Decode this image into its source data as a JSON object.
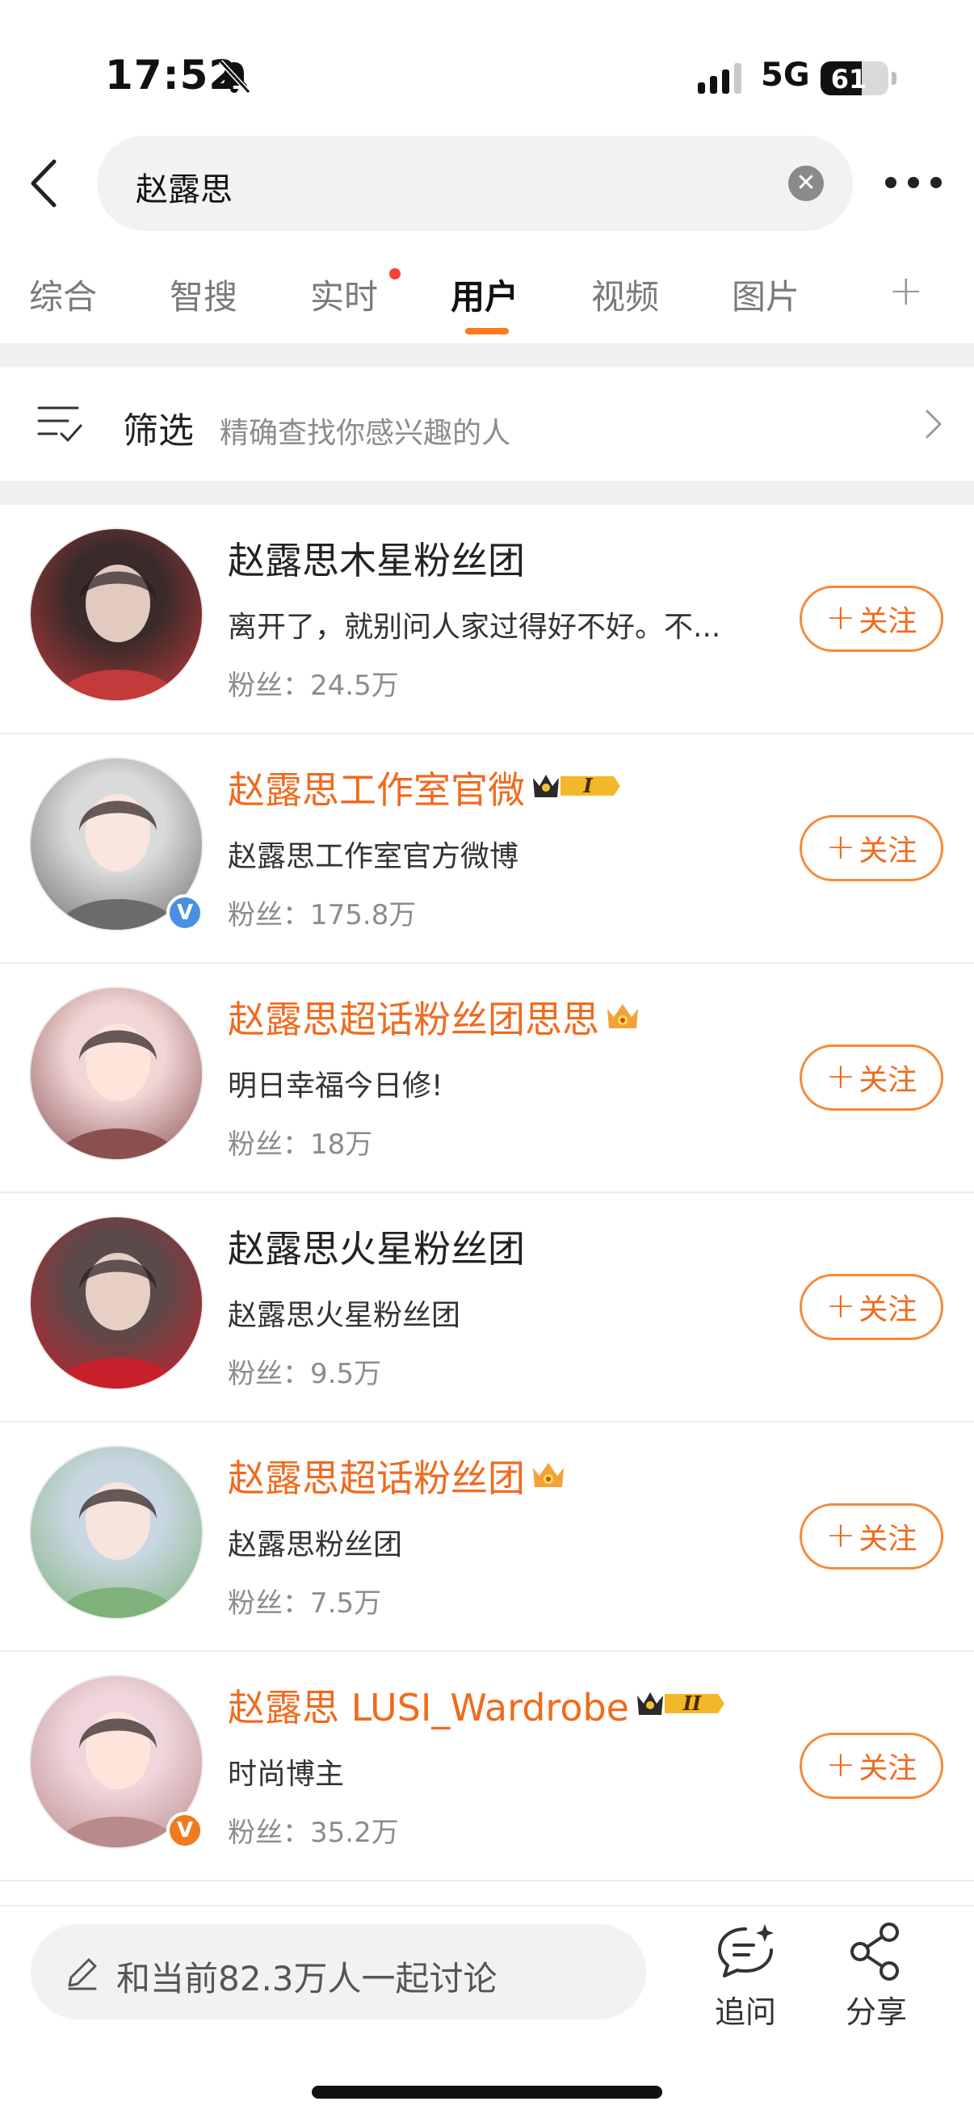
{
  "status_bar": {
    "time": "17:52",
    "network": "5G",
    "battery_level": "61",
    "battery_percent": 61,
    "icons": [
      "bell-muted-icon",
      "signal-bars-icon",
      "battery-icon"
    ]
  },
  "header": {
    "back_icon": "chevron-left-icon",
    "search_query": "赵露思",
    "clear_icon": "close-circle-icon",
    "more_icon": "more-horizontal-icon"
  },
  "tabs": [
    {
      "label": "综合",
      "active": false
    },
    {
      "label": "智搜",
      "active": false
    },
    {
      "label": "实时",
      "active": false,
      "dot": true
    },
    {
      "label": "用户",
      "active": true
    },
    {
      "label": "视频",
      "active": false
    },
    {
      "label": "图片",
      "active": false
    }
  ],
  "tab_add_icon": "plus-icon",
  "filter": {
    "label": "筛选",
    "hint": "精确查找你感兴趣的人",
    "icon": "filter-list-icon",
    "chevron": "chevron-right-icon"
  },
  "follow_label": "关注",
  "users": [
    {
      "name": "赵露思木星粉丝团",
      "desc": "离开了，就别问人家过得好不好。不...",
      "fans": "粉丝：24.5万",
      "highlight": false,
      "avatar_colors": [
        "#3a2a2a",
        "#c23a3a"
      ],
      "verify": null,
      "crown": null
    },
    {
      "name": "赵露思工作室官微",
      "desc": "赵露思工作室官方微博",
      "fans": "粉丝：175.8万",
      "highlight": true,
      "avatar_colors": [
        "#dadada",
        "#6b6b6b"
      ],
      "verify": "blue",
      "crown": "I"
    },
    {
      "name": "赵露思超话粉丝团思思",
      "desc": "明日幸福今日修!",
      "fans": "粉丝：18万",
      "highlight": true,
      "avatar_colors": [
        "#f1d6d6",
        "#8a5050"
      ],
      "verify": null,
      "crown": "small"
    },
    {
      "name": "赵露思火星粉丝团",
      "desc": "赵露思火星粉丝团",
      "fans": "粉丝：9.5万",
      "highlight": false,
      "avatar_colors": [
        "#5a4a4a",
        "#c8202a"
      ],
      "verify": null,
      "crown": null
    },
    {
      "name": "赵露思超话粉丝团",
      "desc": "赵露思粉丝团",
      "fans": "粉丝：7.5万",
      "highlight": true,
      "avatar_colors": [
        "#c9d7e2",
        "#7fb27a"
      ],
      "verify": null,
      "crown": "small"
    },
    {
      "name": "赵露思 LUSI_Wardrobe",
      "desc": "时尚博主",
      "fans": "粉丝：35.2万",
      "highlight": true,
      "avatar_colors": [
        "#efd6dc",
        "#b98a8a"
      ],
      "verify": "orange",
      "crown": "II"
    }
  ],
  "bottom_bar": {
    "discuss_placeholder": "和当前82.3万人一起讨论",
    "discuss_icon": "pencil-icon",
    "ask_label": "追问",
    "ask_icon": "chat-sparkle-icon",
    "share_label": "分享",
    "share_icon": "share-nodes-icon"
  },
  "colors": {
    "accent": "#f06a1e",
    "tab_underline": "#ff7a1a",
    "dot": "#f54236",
    "blue_verify": "#4a90e2",
    "orange_verify": "#f07a1e"
  }
}
